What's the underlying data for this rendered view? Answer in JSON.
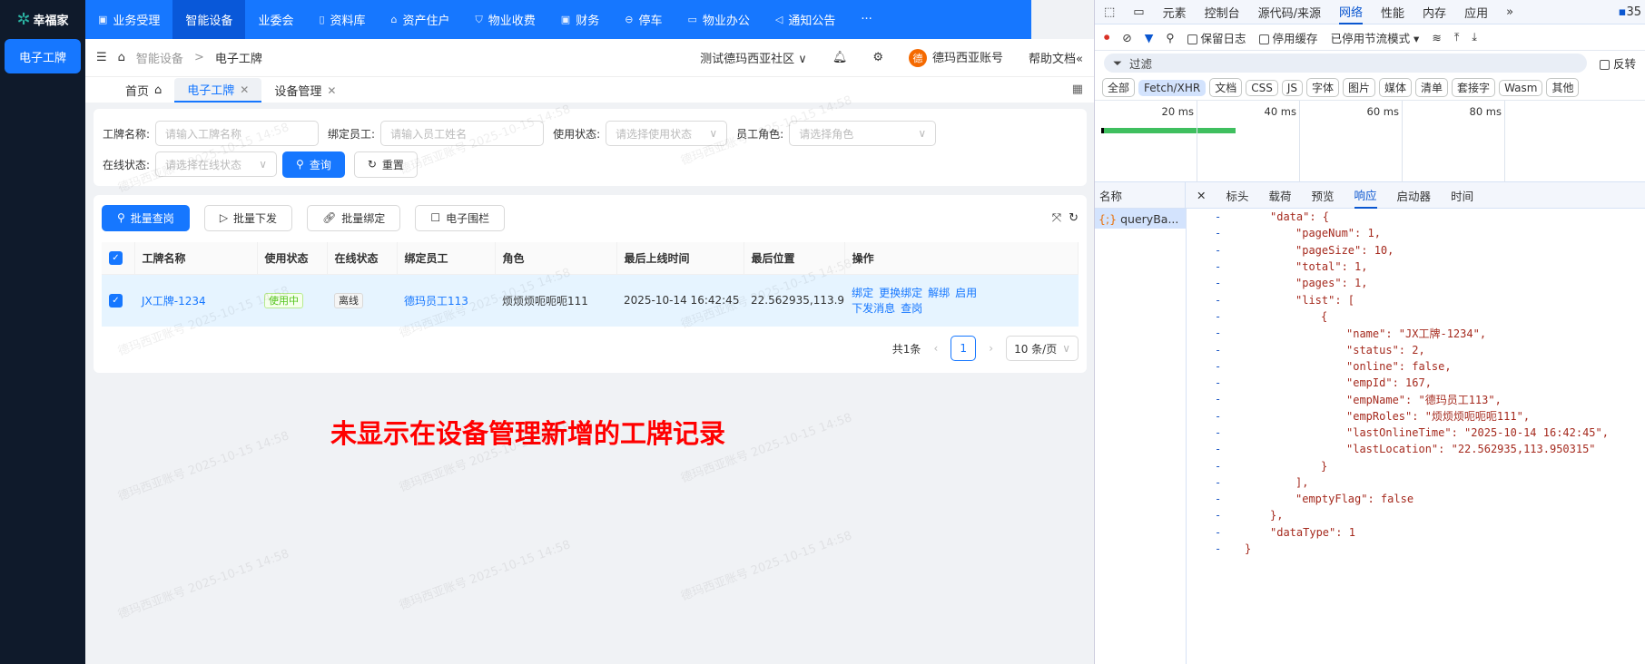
{
  "sidebar": {
    "logo": "幸福家",
    "items": [
      {
        "label": "电子工牌"
      }
    ]
  },
  "topnav": {
    "items": [
      {
        "label": "业务受理",
        "icon": "calendar-icon"
      },
      {
        "label": "智能设备",
        "icon": "",
        "active": true
      },
      {
        "label": "业委会",
        "icon": ""
      },
      {
        "label": "资料库",
        "icon": "file-icon"
      },
      {
        "label": "资产住户",
        "icon": "home-icon"
      },
      {
        "label": "物业收费",
        "icon": "shield-icon"
      },
      {
        "label": "财务",
        "icon": "calendar-icon"
      },
      {
        "label": "停车",
        "icon": "lock-icon"
      },
      {
        "label": "物业办公",
        "icon": "monitor-icon"
      },
      {
        "label": "通知公告",
        "icon": "megaphone-icon"
      },
      {
        "label": "···",
        "icon": ""
      }
    ]
  },
  "header": {
    "breadcrumb": [
      "智能设备",
      "电子工牌"
    ],
    "community": "测试德玛西亚社区",
    "account": "德玛西亚账号",
    "avatar_char": "德",
    "help": "帮助文档"
  },
  "tabs": [
    {
      "label": "首页"
    },
    {
      "label": "电子工牌",
      "active": true
    },
    {
      "label": "设备管理"
    }
  ],
  "filters": {
    "name_label": "工牌名称:",
    "name_placeholder": "请输入工牌名称",
    "emp_label": "绑定员工:",
    "emp_placeholder": "请输入员工姓名",
    "status_label": "使用状态:",
    "status_placeholder": "请选择使用状态",
    "role_label": "员工角色:",
    "role_placeholder": "请选择角色",
    "online_label": "在线状态:",
    "online_placeholder": "请选择在线状态",
    "query": "查询",
    "reset": "重置"
  },
  "toolbar": {
    "batch_query": "批量查岗",
    "batch_send": "批量下发",
    "batch_bind": "批量绑定",
    "fence": "电子围栏"
  },
  "table": {
    "columns": [
      "工牌名称",
      "使用状态",
      "在线状态",
      "绑定员工",
      "角色",
      "最后上线时间",
      "最后位置",
      "操作"
    ],
    "rows": [
      {
        "name": "JX工牌-1234",
        "status": "使用中",
        "online": "离线",
        "employee": "德玛员工113",
        "role": "烦烦烦呃呃呃111",
        "last_online": "2025-10-14 16:42:45",
        "location": "22.562935,113.9",
        "actions": [
          "绑定",
          "更换绑定",
          "解绑",
          "启用",
          "下发消息",
          "查岗"
        ],
        "checked": true
      }
    ]
  },
  "pagination": {
    "total": "共1条",
    "page": "1",
    "page_size": "10 条/页"
  },
  "annotation": "未显示在设备管理新增的工牌记录",
  "watermark": "德玛西亚账号 2025-10-15 14:58",
  "devtools": {
    "tabs": [
      "元素",
      "控制台",
      "源代码/来源",
      "网络",
      "性能",
      "内存",
      "应用"
    ],
    "active_tab": "网络",
    "issues_count": "35",
    "toolbar": {
      "preserve_log": "保留日志",
      "disable_cache": "停用缓存",
      "throttle": "已停用节流模式"
    },
    "filter_placeholder": "过滤",
    "invert": "反转",
    "type_filters": [
      "全部",
      "Fetch/XHR",
      "文档",
      "CSS",
      "JS",
      "字体",
      "图片",
      "媒体",
      "清单",
      "套接字",
      "Wasm",
      "其他"
    ],
    "active_type": "Fetch/XHR",
    "timeline_ticks": [
      "20 ms",
      "40 ms",
      "60 ms",
      "80 ms"
    ],
    "name_header": "名称",
    "request": "queryBa...",
    "detail_tabs": [
      "标头",
      "载荷",
      "预览",
      "响应",
      "启动器",
      "时间"
    ],
    "active_detail": "响应",
    "response_lines": [
      {
        "indent": 1,
        "text": "\"data\": {"
      },
      {
        "indent": 2,
        "text": "\"pageNum\": 1,"
      },
      {
        "indent": 2,
        "text": "\"pageSize\": 10,"
      },
      {
        "indent": 2,
        "text": "\"total\": 1,"
      },
      {
        "indent": 2,
        "text": "\"pages\": 1,"
      },
      {
        "indent": 2,
        "text": "\"list\": ["
      },
      {
        "indent": 3,
        "text": "{"
      },
      {
        "indent": 4,
        "text": "\"name\": \"JX工牌-1234\","
      },
      {
        "indent": 4,
        "text": "\"status\": 2,"
      },
      {
        "indent": 4,
        "text": "\"online\": false,"
      },
      {
        "indent": 4,
        "text": "\"empId\": 167,"
      },
      {
        "indent": 4,
        "text": "\"empName\": \"德玛员工113\","
      },
      {
        "indent": 4,
        "text": "\"empRoles\": \"烦烦烦呃呃呃111\","
      },
      {
        "indent": 4,
        "text": "\"lastOnlineTime\": \"2025-10-14 16:42:45\","
      },
      {
        "indent": 4,
        "text": "\"lastLocation\": \"22.562935,113.950315\""
      },
      {
        "indent": 3,
        "text": "}"
      },
      {
        "indent": 2,
        "text": "],"
      },
      {
        "indent": 2,
        "text": "\"emptyFlag\": false"
      },
      {
        "indent": 1,
        "text": "},"
      },
      {
        "indent": 1,
        "text": "\"dataType\": 1"
      },
      {
        "indent": 0,
        "text": "}"
      }
    ]
  }
}
